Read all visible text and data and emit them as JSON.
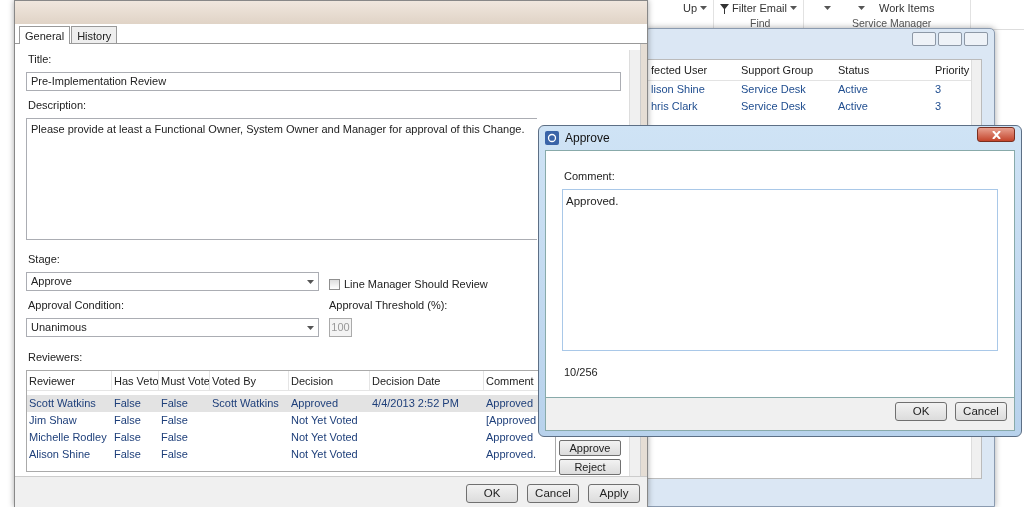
{
  "ribbon": {
    "buttons": [
      {
        "label": "Up",
        "dropdown": true
      },
      {
        "label": "Filter Email",
        "dropdown": true
      },
      {
        "label": "Work Items",
        "dropdown": false
      }
    ],
    "groups": [
      "Find",
      "Service Manager"
    ]
  },
  "background_window": {
    "columns": [
      "fected User",
      "Support Group",
      "Status",
      "Priority"
    ],
    "rows": [
      [
        "lison Shine",
        "Service Desk",
        "Active",
        "3"
      ],
      [
        "hris Clark",
        "Service Desk",
        "Active",
        "3"
      ]
    ]
  },
  "change_dialog": {
    "tabs": [
      {
        "label": "General",
        "selected": true
      },
      {
        "label": "History",
        "selected": false
      }
    ],
    "title_label": "Title:",
    "title_value": "Pre-Implementation Review",
    "description_label": "Description:",
    "description_value": "Please provide at least a Functional Owner, System Owner and Manager for approval of this Change.",
    "stage_label": "Stage:",
    "stage_value": "Approve",
    "line_manager": {
      "label": "Line Manager Should Review",
      "checked": false
    },
    "condition_label": "Approval Condition:",
    "condition_value": "Unanimous",
    "threshold_label": "Approval Threshold (%):",
    "threshold": {
      "value": "100",
      "disabled": true
    },
    "reviewers_label": "Reviewers:",
    "reviewers": {
      "columns": [
        "Reviewer",
        "Has Veto",
        "Must Vote",
        "Voted By",
        "Decision",
        "Decision Date",
        "Comment"
      ],
      "rows": [
        {
          "cells": [
            "Scott Watkins",
            "False",
            "False",
            "Scott Watkins",
            "Approved",
            "4/4/2013 2:52 PM",
            "Approved"
          ],
          "selected": true
        },
        {
          "cells": [
            "Jim Shaw",
            "False",
            "False",
            "",
            "Not Yet Voted",
            "",
            "[Approved"
          ],
          "selected": false
        },
        {
          "cells": [
            "Michelle Rodley",
            "False",
            "False",
            "",
            "Not Yet Voted",
            "",
            "Approved"
          ],
          "selected": false
        },
        {
          "cells": [
            "Alison Shine",
            "False",
            "False",
            "",
            "Not Yet Voted",
            "",
            "Approved."
          ],
          "selected": false
        }
      ]
    },
    "side_buttons": [
      "Approve",
      "Reject"
    ],
    "buttons": [
      "OK",
      "Cancel",
      "Apply"
    ]
  },
  "approve_dialog": {
    "title": "Approve",
    "comment_label": "Comment:",
    "comment_value": "Approved.",
    "counter": "10/256",
    "buttons": [
      "OK",
      "Cancel"
    ]
  }
}
